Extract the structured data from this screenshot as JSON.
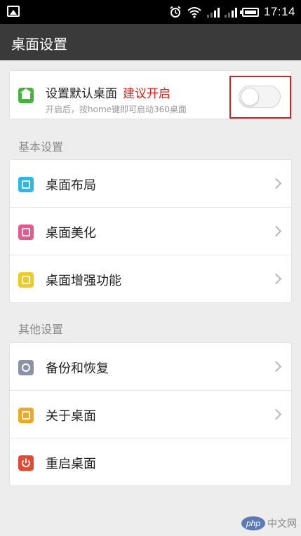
{
  "status_bar": {
    "time": "17:14",
    "icons": [
      "image-icon",
      "alarm-icon",
      "wifi-icon",
      "signal-icon",
      "battery-icon"
    ]
  },
  "header": {
    "title": "桌面设置"
  },
  "default_launcher": {
    "title": "设置默认桌面",
    "recommend": "建议开启",
    "subtitle": "开启后，按home键即可启动360桌面",
    "toggle_on": false,
    "icon": "home-icon"
  },
  "basic_section": {
    "title": "基本设置",
    "items": [
      {
        "label": "桌面布局",
        "icon": "layout-icon",
        "color": "#2cb8e6"
      },
      {
        "label": "桌面美化",
        "icon": "beautify-icon",
        "color": "#e9588b"
      },
      {
        "label": "桌面增强功能",
        "icon": "enhance-icon",
        "color": "#f0cc1e"
      }
    ]
  },
  "other_section": {
    "title": "其他设置",
    "items": [
      {
        "label": "备份和恢复",
        "icon": "backup-icon",
        "color": "#8a93a5"
      },
      {
        "label": "关于桌面",
        "icon": "about-icon",
        "color": "#f2a81c"
      },
      {
        "label": "重启桌面",
        "icon": "power-icon",
        "color": "#e6492d"
      }
    ]
  },
  "watermark": {
    "logo": "php",
    "text": "中文网"
  },
  "colors": {
    "accent": "#d8261c",
    "titlebar": "#3a3a3a",
    "highlight": "#c9252b"
  }
}
